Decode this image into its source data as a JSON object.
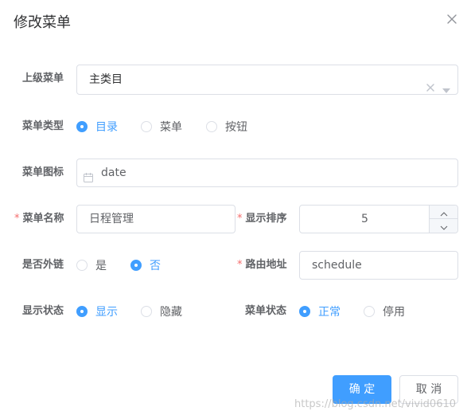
{
  "dialog": {
    "title": "修改菜单",
    "close_icon": "close-icon"
  },
  "form": {
    "parent_menu": {
      "label": "上级菜单",
      "value": "主类目",
      "clear_icon": "clear-icon",
      "dropdown_icon": "caret-down-icon"
    },
    "menu_type": {
      "label": "菜单类型",
      "options": [
        "目录",
        "菜单",
        "按钮"
      ],
      "selected": "目录"
    },
    "menu_icon": {
      "label": "菜单图标",
      "value": "date",
      "icon": "calendar-icon"
    },
    "menu_name": {
      "label": "菜单名称",
      "required_mark": "*",
      "value": "日程管理"
    },
    "display_order": {
      "label": "显示排序",
      "required_mark": "*",
      "value": "5"
    },
    "is_external": {
      "label": "是否外链",
      "options": [
        "是",
        "否"
      ],
      "selected": "否"
    },
    "route_path": {
      "label": "路由地址",
      "required_mark": "*",
      "value": "schedule"
    },
    "display_status": {
      "label": "显示状态",
      "options": [
        "显示",
        "隐藏"
      ],
      "selected": "显示"
    },
    "menu_status": {
      "label": "菜单状态",
      "options": [
        "正常",
        "停用"
      ],
      "selected": "正常"
    }
  },
  "footer": {
    "confirm_label": "确 定",
    "cancel_label": "取 消"
  },
  "watermark": "https://blog.csdn.net/vivid0610",
  "colors": {
    "primary": "#409eff",
    "required": "#f56c6c",
    "text": "#606266",
    "border": "#dcdfe6"
  }
}
